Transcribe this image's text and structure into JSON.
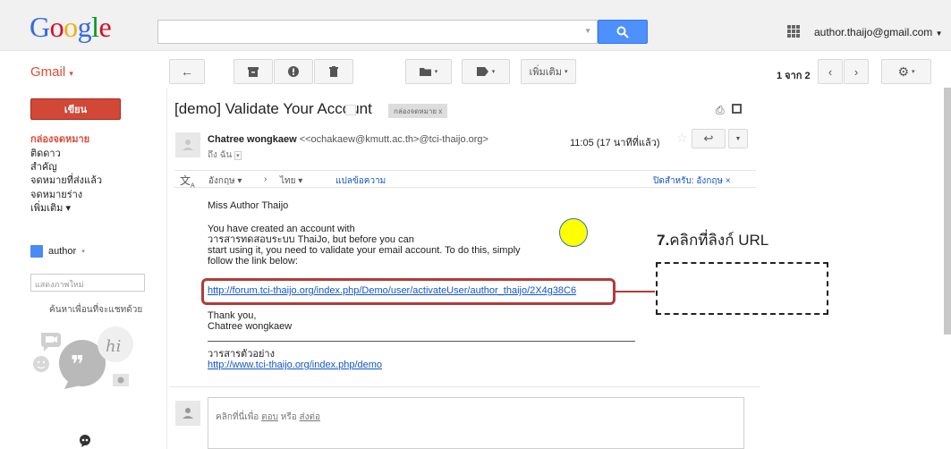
{
  "header": {
    "logo": {
      "letters": [
        "G",
        "o",
        "o",
        "g",
        "l",
        "e"
      ],
      "colors": [
        "#3369e8",
        "#d50f25",
        "#eeb211",
        "#3369e8",
        "#009925",
        "#d50f25"
      ]
    },
    "search": {
      "placeholder": ""
    },
    "account_email": "author.thaijo@gmail.com"
  },
  "toolbar": {
    "app_label": "Gmail",
    "more_label": "เพิ่มเติม",
    "pager": "1 จาก 2"
  },
  "sidebar": {
    "compose_label": "เขียน",
    "items": [
      {
        "label": "กล่องจดหมาย",
        "active": true
      },
      {
        "label": "ติดดาว",
        "active": false
      },
      {
        "label": "สำคัญ",
        "active": false
      },
      {
        "label": "จดหมายที่ส่งแล้ว",
        "active": false
      },
      {
        "label": "จดหมายร่าง",
        "active": false
      },
      {
        "label": "เพิ่มเติม ▾",
        "active": false
      }
    ],
    "user_name": "author",
    "search_people_placeholder": "แสดงภาพใหม่",
    "find_people_label": "ค้นหาเพื่อนที่จะแชทด้วย"
  },
  "message": {
    "subject": "[demo] Validate Your Account",
    "label_chip": "กล่องจดหมาย  x",
    "sender_name": "Chatree wongkaew",
    "sender_email": "<<ochakaew@kmutt.ac.th>@tci-thaijo.org>",
    "to_line": "ถึง ฉัน",
    "time": "11:05 (17 นาทีที่แล้ว)",
    "translate": {
      "from_lang": "อังกฤษ ▾",
      "to_lang": "ไทย ▾",
      "translate_link": "แปลข้อความ",
      "turn_off": "ปิดสำหรับ: อังกฤษ ×"
    },
    "greeting": "Miss Author Thaijo",
    "body_lines": [
      "You have created an account with",
      "วารสารทดสอบระบบ ThaiJo, but before you can",
      "start using it, you need to validate your email account. To do this, simply",
      "follow the link below:"
    ],
    "activation_link": "http://forum.tci-thaijo.org/index.php/Demo/user/activateUser/author_thaijo/2X4g38C6",
    "thanks_lines": [
      "Thank you,",
      "Chatree wongkaew"
    ],
    "signature_title": "วารสารตัวอย่าง",
    "signature_link": "http://www.tci-thaijo.org/index.php/demo",
    "reply_prompt_prefix": "คลิกที่นี่เพื่อ ",
    "reply_word": "ตอบ",
    "reply_or": " หรือ ",
    "forward_word": "ส่งต่อ"
  },
  "annotation": {
    "step_number": "7.",
    "step_text": "คลิกที่ลิงก์ URL",
    "highlight_color": "#b33a3a",
    "marker_color": "#ffff00"
  }
}
